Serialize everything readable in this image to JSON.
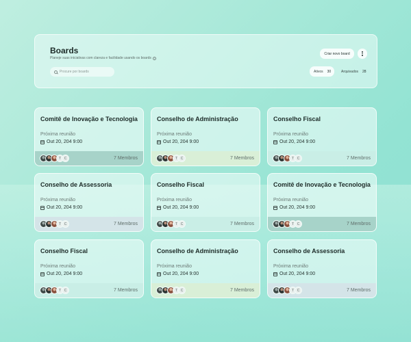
{
  "header": {
    "title": "Boards",
    "subtitle": "Planeje suas iniciativas com clareza e facilidade usando os boards",
    "info_icon": "info-icon",
    "search_placeholder": "Procure por boards",
    "new_board_label": "Criar novo board",
    "more_icon": "more-vertical-icon",
    "tabs": [
      {
        "label": "Ativos",
        "count": "30"
      },
      {
        "label": "Arquivados",
        "count": "28"
      }
    ]
  },
  "cards": [
    {
      "title": "Comitê de Inovação e Tecnologia",
      "meeting_label": "Próxima reunião",
      "date": "Out 20, 204 9:00",
      "members": "7 Membros",
      "initials": [
        "T",
        "C"
      ],
      "footer_color": "#a7d3c9"
    },
    {
      "title": "Conselho de Administração",
      "meeting_label": "Próxima reunião",
      "date": "Out 20, 204 9:00",
      "members": "7 Membros",
      "initials": [
        "T",
        "C"
      ],
      "footer_color": "#d9efd7"
    },
    {
      "title": "Conselho Fiscal",
      "meeting_label": "Próxima reunião",
      "date": "Out 20, 204 9:00",
      "members": "7 Membros",
      "initials": [
        "T",
        "C"
      ],
      "footer_color": "#c9eee6"
    },
    {
      "title": "Conselho de Assessoria",
      "meeting_label": "Próxima reunião",
      "date": "Out 20, 204 9:00",
      "members": "7 Membros",
      "initials": [
        "T",
        "C"
      ],
      "footer_color": "#d4e4e8"
    },
    {
      "title": "Conselho Fiscal",
      "meeting_label": "Próxima reunião",
      "date": "Out 20, 204 9:00",
      "members": "7 Membros",
      "initials": [
        "T",
        "C"
      ],
      "footer_color": "#c9eee6"
    },
    {
      "title": "Comitê de Inovação e Tecnologia",
      "meeting_label": "Próxima reunião",
      "date": "Out 20, 204 9:00",
      "members": "7 Membros",
      "initials": [
        "T",
        "C"
      ],
      "footer_color": "#a7d3c9"
    },
    {
      "title": "Conselho Fiscal",
      "meeting_label": "Próxima reunião",
      "date": "Out 20, 204 9:00",
      "members": "7 Membros",
      "initials": [
        "T",
        "C"
      ],
      "footer_color": "#c9eee6"
    },
    {
      "title": "Conselho de Administração",
      "meeting_label": "Próxima reunião",
      "date": "Out 20, 204 9:00",
      "members": "7 Membros",
      "initials": [
        "T",
        "C"
      ],
      "footer_color": "#d9efd7"
    },
    {
      "title": "Conselho de Assessoria",
      "meeting_label": "Próxima reunião",
      "date": "Out 20, 204 9:00",
      "members": "7 Membros",
      "initials": [
        "T",
        "C"
      ],
      "footer_color": "#d4e4e8"
    }
  ],
  "icons": {
    "search": "search-icon",
    "calendar": "calendar-icon"
  }
}
